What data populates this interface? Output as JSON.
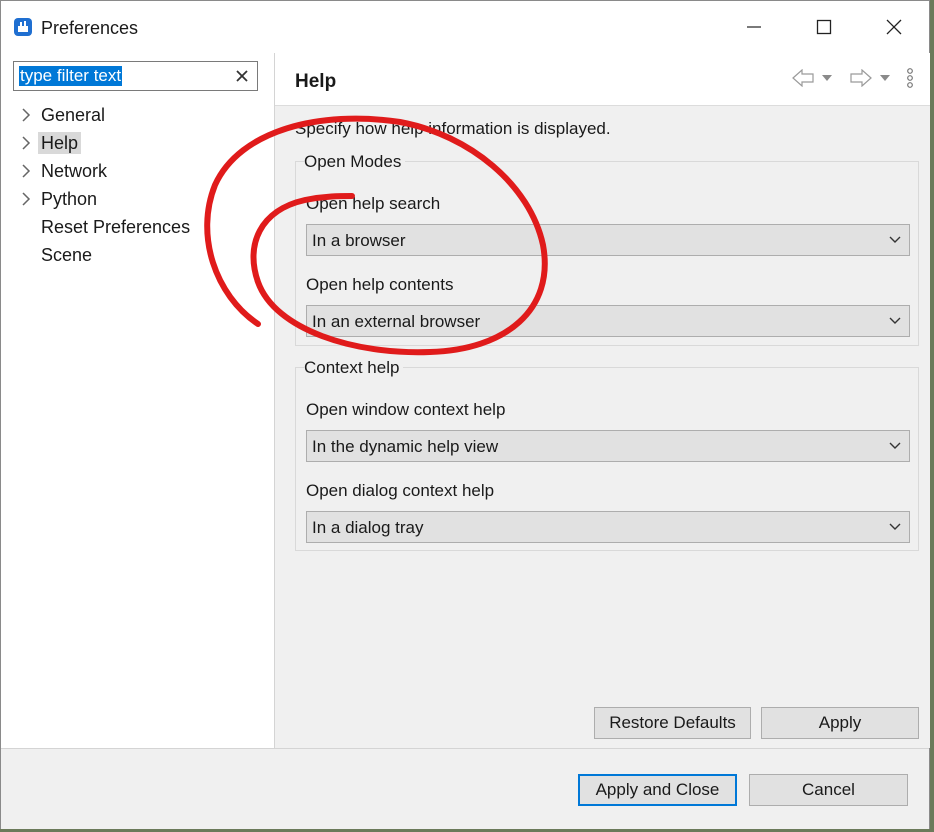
{
  "window": {
    "title": "Preferences",
    "icon": "eclipse-app-icon"
  },
  "left": {
    "filter": {
      "value": "type filter text"
    },
    "tree": [
      {
        "label": "General",
        "expandable": true
      },
      {
        "label": "Help",
        "expandable": true,
        "selected": true
      },
      {
        "label": "Network",
        "expandable": true
      },
      {
        "label": "Python",
        "expandable": true
      },
      {
        "label": "Reset Preferences",
        "expandable": false
      },
      {
        "label": "Scene",
        "expandable": false
      }
    ]
  },
  "page": {
    "title": "Help",
    "description": "Specify how help information is displayed.",
    "groups": [
      {
        "title": "Open Modes",
        "fields": [
          {
            "label": "Open help search",
            "value": "In a browser"
          },
          {
            "label": "Open help contents",
            "value": "In an external browser"
          }
        ]
      },
      {
        "title": "Context help",
        "fields": [
          {
            "label": "Open window context help",
            "value": "In the dynamic help view"
          },
          {
            "label": "Open dialog context help",
            "value": "In a dialog tray"
          }
        ]
      }
    ],
    "restore_defaults_label": "Restore Defaults",
    "apply_label": "Apply"
  },
  "dialog_buttons": {
    "apply_close_label": "Apply and Close",
    "cancel_label": "Cancel"
  },
  "colors": {
    "selection": "#0078d7",
    "annotation": "#e01b1b"
  }
}
